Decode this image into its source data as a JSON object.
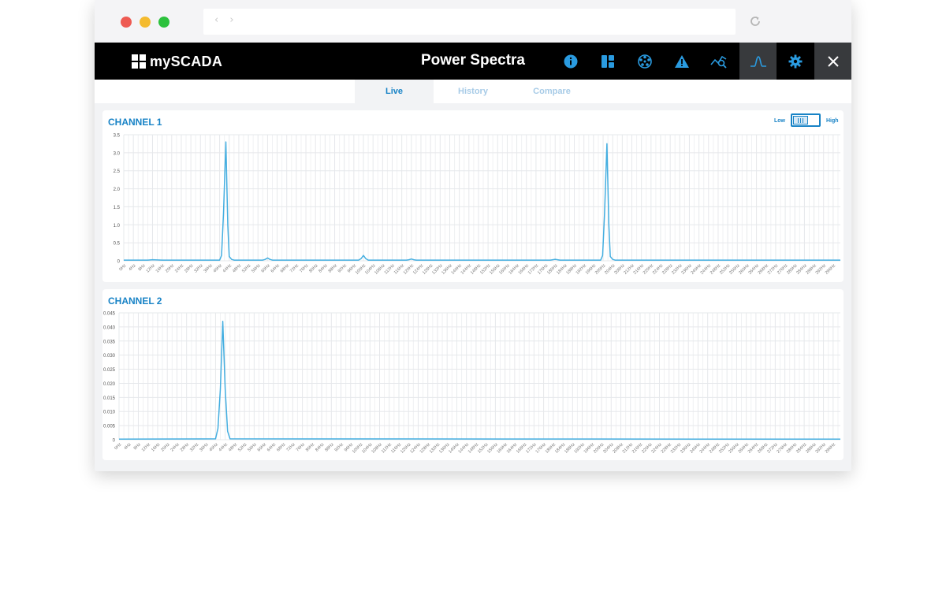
{
  "window": {
    "traffic_lights": [
      "#ee5a52",
      "#f4bb2f",
      "#2cc13d"
    ]
  },
  "addressbar": {
    "nav_arrows": "‹ ›",
    "reload_icon": "reload-icon"
  },
  "app": {
    "logo_text": "mySCADA",
    "title": "Power Spectra"
  },
  "toolbar": {
    "icons": [
      "info-icon",
      "dashboard-icon",
      "network-icon",
      "alarm-icon",
      "trend-icon",
      "spectrum-icon",
      "gear-icon",
      "close-icon"
    ],
    "active": "spectrum-icon"
  },
  "tabs": [
    {
      "label": "Live",
      "active": true
    },
    {
      "label": "History",
      "active": false
    },
    {
      "label": "Compare",
      "active": false
    }
  ],
  "resolution_toggle": {
    "low_label": "Low",
    "high_label": "High"
  },
  "colors": {
    "accent": "#1883c6",
    "line": "#44aee0",
    "grid": "#e6e8eb"
  },
  "chart_data": [
    {
      "type": "line",
      "title": "CHANNEL 1",
      "ylim": [
        0,
        3.5
      ],
      "yticks": [
        "0",
        "0.5",
        "1.0",
        "1.5",
        "2.0",
        "2.5",
        "3.0",
        "3.5"
      ],
      "xticks": [
        "0Hz",
        "4Hz",
        "8Hz",
        "12Hz",
        "16Hz",
        "20Hz",
        "24Hz",
        "28Hz",
        "32Hz",
        "36Hz",
        "40Hz",
        "44Hz",
        "48Hz",
        "52Hz",
        "56Hz",
        "60Hz",
        "64Hz",
        "68Hz",
        "72Hz",
        "76Hz",
        "80Hz",
        "84Hz",
        "88Hz",
        "92Hz",
        "96Hz",
        "100Hz",
        "104Hz",
        "108Hz",
        "112Hz",
        "116Hz",
        "120Hz",
        "124Hz",
        "128Hz",
        "132Hz",
        "136Hz",
        "140Hz",
        "144Hz",
        "148Hz",
        "152Hz",
        "156Hz",
        "160Hz",
        "164Hz",
        "168Hz",
        "172Hz",
        "176Hz",
        "180Hz",
        "184Hz",
        "188Hz",
        "192Hz",
        "196Hz",
        "200Hz",
        "204Hz",
        "208Hz",
        "212Hz",
        "216Hz",
        "220Hz",
        "224Hz",
        "228Hz",
        "232Hz",
        "236Hz",
        "240Hz",
        "244Hz",
        "248Hz",
        "252Hz",
        "256Hz",
        "260Hz",
        "264Hz",
        "268Hz",
        "272Hz",
        "276Hz",
        "280Hz",
        "284Hz",
        "288Hz",
        "292Hz",
        "296Hz"
      ],
      "x_max": 299,
      "grid": true,
      "series": [
        {
          "x": [
            0,
            10,
            12,
            16,
            40,
            40.8,
            41.6,
            42.6,
            43.4,
            44,
            45,
            46,
            58,
            59,
            60,
            61,
            62,
            98,
            99,
            100,
            101,
            102,
            118,
            119,
            120,
            121,
            122,
            178,
            179,
            180,
            181,
            182,
            199,
            199.8,
            200.6,
            201.6,
            202.4,
            203,
            204,
            205,
            299
          ],
          "y": [
            0.02,
            0.02,
            0.03,
            0.02,
            0.02,
            0.15,
            1.3,
            3.3,
            1.0,
            0.12,
            0.04,
            0.02,
            0.02,
            0.04,
            0.08,
            0.04,
            0.02,
            0.02,
            0.06,
            0.15,
            0.06,
            0.02,
            0.02,
            0.03,
            0.05,
            0.03,
            0.02,
            0.02,
            0.03,
            0.04,
            0.03,
            0.02,
            0.02,
            0.15,
            1.3,
            3.25,
            1.0,
            0.12,
            0.04,
            0.02,
            0.02
          ]
        }
      ]
    },
    {
      "type": "line",
      "title": "CHANNEL 2",
      "ylim": [
        0,
        0.045
      ],
      "yticks": [
        "0",
        "0.005",
        "0.010",
        "0.015",
        "0.020",
        "0.025",
        "0.030",
        "0.035",
        "0.040",
        "0.045"
      ],
      "xticks": [
        "0Hz",
        "4Hz",
        "8Hz",
        "12Hz",
        "16Hz",
        "20Hz",
        "24Hz",
        "28Hz",
        "32Hz",
        "36Hz",
        "40Hz",
        "44Hz",
        "48Hz",
        "52Hz",
        "56Hz",
        "60Hz",
        "64Hz",
        "68Hz",
        "72Hz",
        "76Hz",
        "80Hz",
        "84Hz",
        "88Hz",
        "92Hz",
        "96Hz",
        "100Hz",
        "104Hz",
        "108Hz",
        "112Hz",
        "116Hz",
        "120Hz",
        "124Hz",
        "128Hz",
        "132Hz",
        "136Hz",
        "140Hz",
        "144Hz",
        "148Hz",
        "152Hz",
        "156Hz",
        "160Hz",
        "164Hz",
        "168Hz",
        "172Hz",
        "176Hz",
        "180Hz",
        "184Hz",
        "188Hz",
        "192Hz",
        "196Hz",
        "200Hz",
        "204Hz",
        "208Hz",
        "212Hz",
        "216Hz",
        "220Hz",
        "224Hz",
        "228Hz",
        "232Hz",
        "236Hz",
        "240Hz",
        "244Hz",
        "248Hz",
        "252Hz",
        "256Hz",
        "260Hz",
        "264Hz",
        "268Hz",
        "272Hz",
        "276Hz",
        "280Hz",
        "284Hz",
        "288Hz",
        "292Hz",
        "296Hz"
      ],
      "x_max": 299,
      "grid": true,
      "series": [
        {
          "x": [
            0,
            40,
            41,
            42,
            43,
            44,
            45,
            46,
            299
          ],
          "y": [
            0.0002,
            0.0003,
            0.004,
            0.018,
            0.042,
            0.018,
            0.003,
            0.0003,
            0.0002
          ]
        }
      ]
    }
  ]
}
